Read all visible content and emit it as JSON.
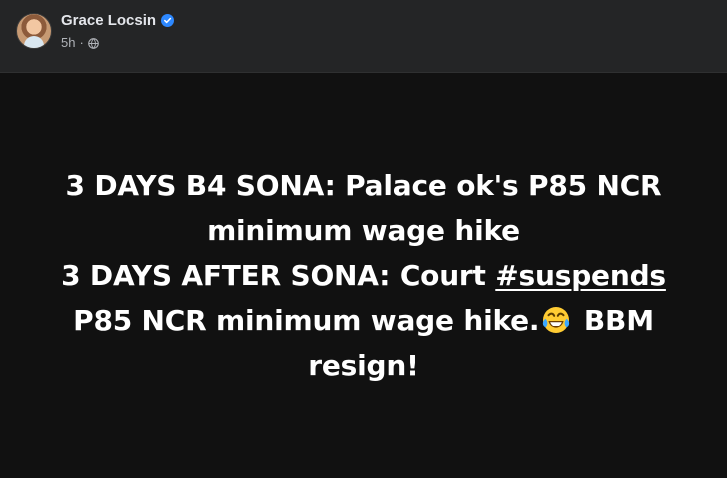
{
  "post": {
    "author": {
      "name": "Grace Locsin",
      "verified_icon": "verified-badge-icon",
      "avatar_icon": "profile-photo-icon"
    },
    "meta": {
      "time": "5h",
      "separator": "·",
      "privacy_icon": "globe-icon"
    },
    "body": {
      "line1": "3 DAYS B4 SONA: Palace ok's P85 NCR",
      "line2": "minimum wage hike",
      "line3_prefix": "3 DAYS AFTER SONA: Court ",
      "hashtag": "#suspends",
      "line4_prefix": "P85 NCR minimum wage hike.",
      "emoji_icon": "tears-of-joy-emoji-icon",
      "line4_suffix": " BBM",
      "line5": "resign!"
    },
    "colors": {
      "header_background": "#242526",
      "post_background": "#111111",
      "text": "#ffffff",
      "secondary_text": "#b0b3b8",
      "verified": "#2d88ff"
    }
  }
}
